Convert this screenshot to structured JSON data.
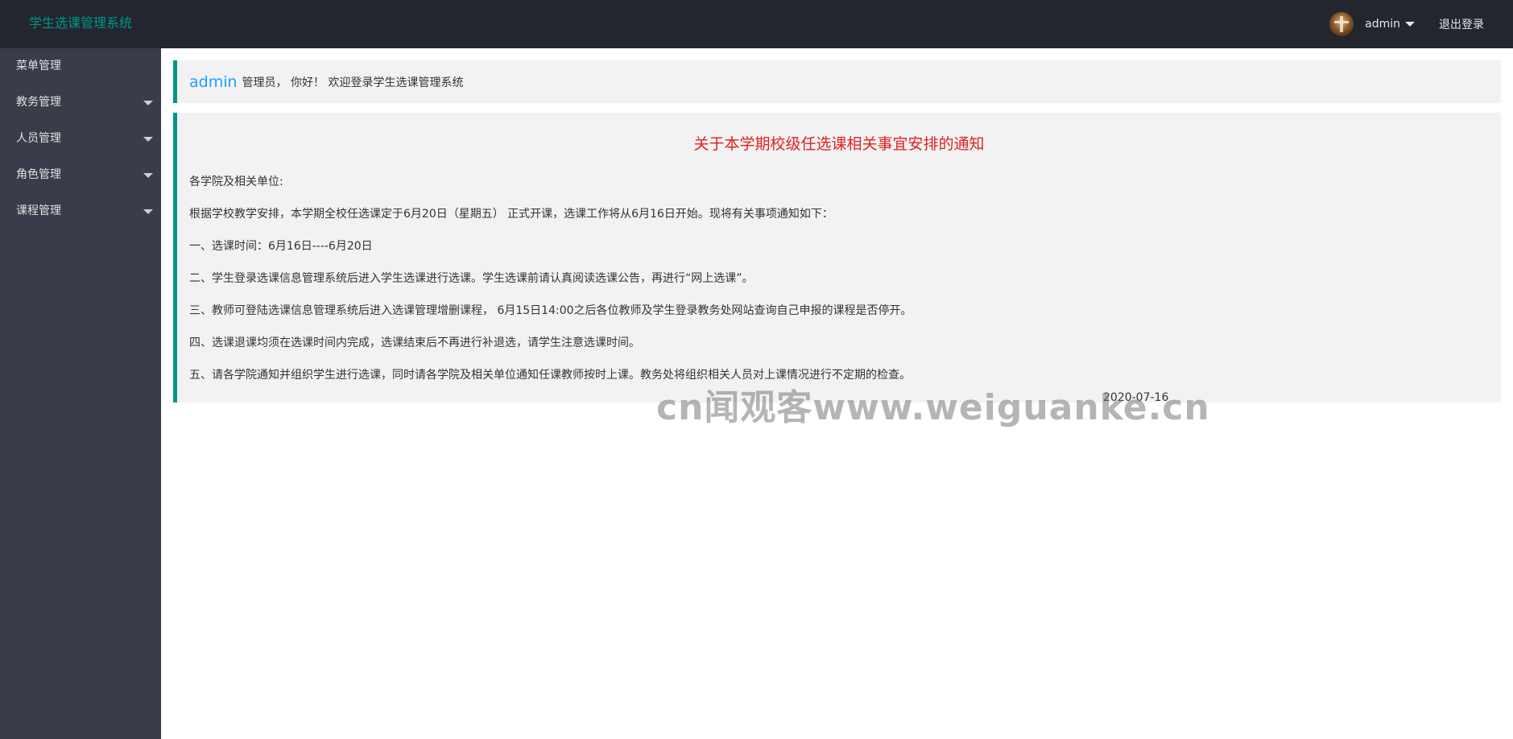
{
  "header": {
    "logo": "学生选课管理系统",
    "user_name": "admin",
    "logout_label": "退出登录"
  },
  "sidebar": {
    "items": [
      {
        "label": "菜单管理"
      },
      {
        "label": "教务管理"
      },
      {
        "label": "人员管理"
      },
      {
        "label": "角色管理"
      },
      {
        "label": "课程管理"
      }
    ]
  },
  "welcome": {
    "admin_name": "admin",
    "text": "管理员， 你好！ 欢迎登录学生选课管理系统"
  },
  "notice": {
    "title": "关于本学期校级任选课相关事宜安排的通知",
    "lines": [
      "各学院及相关单位:",
      "根据学校教学安排，本学期全校任选课定于6月20日（星期五） 正式开课，选课工作将从6月16日开始。现将有关事项通知如下：",
      "一、选课时间：6月16日----6月20日",
      "二、学生登录选课信息管理系统后进入学生选课进行选课。学生选课前请认真阅读选课公告，再进行“网上选课”。",
      "三、教师可登陆选课信息管理系统后进入选课管理增删课程， 6月15日14:00之后各位教师及学生登录教务处网站查询自己申报的课程是否停开。",
      "四、选课退课均须在选课时间内完成，选课结束后不再进行补退选，请学生注意选课时间。",
      "五、请各学院通知并组织学生进行选课，同时请各学院及相关单位通知任课教师按时上课。教务处将组织相关人员对上课情况进行不定期的检查。"
    ],
    "date": "2020-07-16"
  },
  "watermark": "cn闻观客www.weiguanke.cn"
}
